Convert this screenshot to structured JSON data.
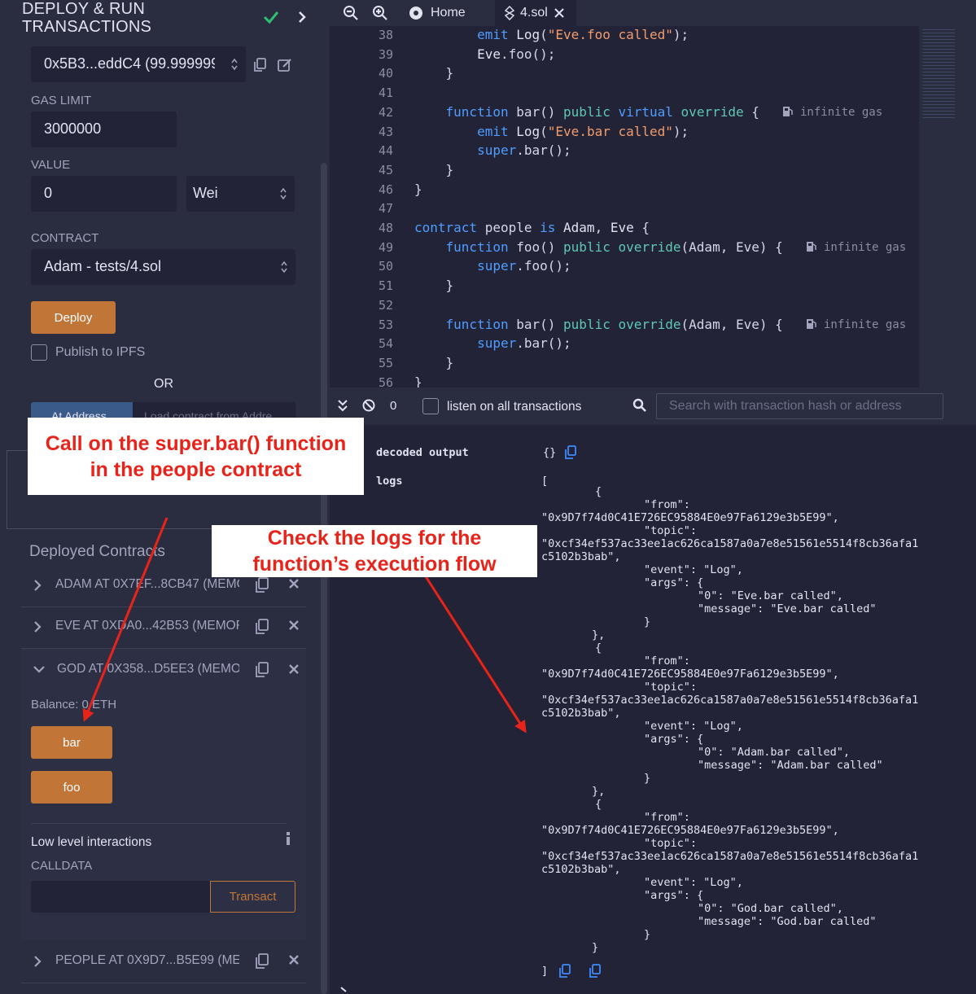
{
  "left_panel": {
    "title_line1": "DEPLOY & RUN",
    "title_line2": "TRANSACTIONS",
    "account": "0x5B3...eddC4 (99.999999",
    "gas_limit_label": "GAS LIMIT",
    "gas_limit_value": "3000000",
    "value_label": "VALUE",
    "value_amount": "0",
    "value_unit": "Wei",
    "contract_label": "CONTRACT",
    "contract_selected": "Adam - tests/4.sol",
    "deploy_label": "Deploy",
    "publish_label": "Publish to IPFS",
    "or_label": "OR",
    "at_address_label": "At Address",
    "load_placeholder": "Load contract from Addre",
    "deployed_title": "Deployed Contracts",
    "contracts": [
      {
        "name": "ADAM AT 0X7EF...8CB47 (MEMC"
      },
      {
        "name": "EVE AT 0XDA0...42B53 (MEMOR"
      },
      {
        "name": "GOD AT 0X358...D5EE3 (MEMOF"
      },
      {
        "name": "PEOPLE AT 0X9D7...B5E99 (MEM"
      }
    ],
    "balance": "Balance: 0 ETH",
    "bar_label": "bar",
    "foo_label": "foo",
    "low_level_label": "Low level interactions",
    "calldata_label": "CALLDATA",
    "transact_label": "Transact"
  },
  "tabs": {
    "home": "Home",
    "file": "4.sol"
  },
  "code": {
    "lines": [
      {
        "n": "38"
      },
      {
        "n": "39"
      },
      {
        "n": "40"
      },
      {
        "n": "41"
      },
      {
        "n": "42"
      },
      {
        "n": "43"
      },
      {
        "n": "44"
      },
      {
        "n": "45"
      },
      {
        "n": "46"
      },
      {
        "n": "47"
      },
      {
        "n": "48"
      },
      {
        "n": "49"
      },
      {
        "n": "50"
      },
      {
        "n": "51"
      },
      {
        "n": "52"
      },
      {
        "n": "53"
      },
      {
        "n": "54"
      },
      {
        "n": "55"
      },
      {
        "n": "56"
      }
    ],
    "gas_hint": "infinite gas"
  },
  "terminal": {
    "count": "0",
    "listen_label": "listen on all transactions",
    "search_placeholder": "Search with transaction hash or address",
    "decoded_label": "decoded output",
    "decoded_value": "{}",
    "logs_label": "logs",
    "open_bracket": "[",
    "close_bracket": "]",
    "logs": [
      {
        "from": "0x9D7f74d0C41E726EC95884E0e97Fa6129e3b5E99",
        "topic1": "0xcf34ef537ac33ee1ac626ca1587a0a7e8e51561e5514f8cb36afa1",
        "topic2": "c5102b3bab",
        "event": "Log",
        "arg0": "Eve.bar called",
        "message": "Eve.bar called"
      },
      {
        "from": "0x9D7f74d0C41E726EC95884E0e97Fa6129e3b5E99",
        "topic1": "0xcf34ef537ac33ee1ac626ca1587a0a7e8e51561e5514f8cb36afa1",
        "topic2": "c5102b3bab",
        "event": "Log",
        "arg0": "Adam.bar called",
        "message": "Adam.bar called"
      },
      {
        "from": "0x9D7f74d0C41E726EC95884E0e97Fa6129e3b5E99",
        "topic1": "0xcf34ef537ac33ee1ac626ca1587a0a7e8e51561e5514f8cb36afa1",
        "topic2": "c5102b3bab",
        "event": "Log",
        "arg0": "God.bar called",
        "message": "God.bar called"
      }
    ]
  },
  "annotations": {
    "callout1_line1": "Call on the super.bar() function",
    "callout1_line2": "in the people contract",
    "callout2_line1": "Check the logs for the",
    "callout2_line2": "function’s execution flow"
  },
  "colors": {
    "accent": "#c17638",
    "annotation": "#e8241a",
    "background": "#222336"
  }
}
